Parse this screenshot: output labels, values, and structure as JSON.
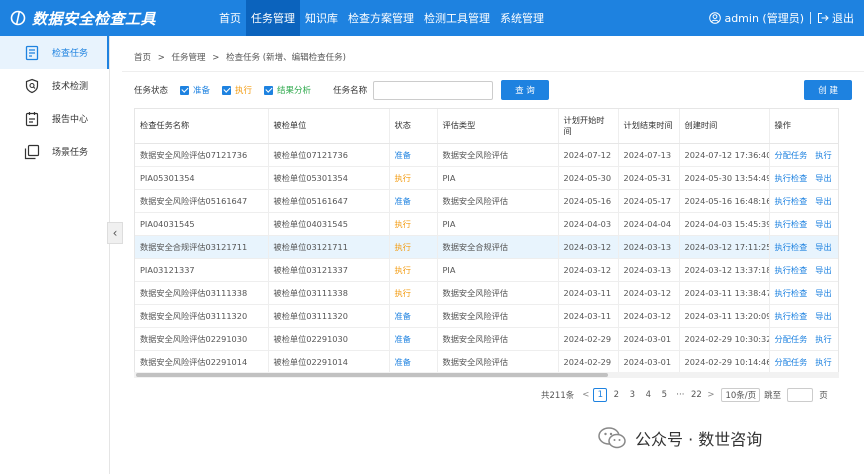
{
  "app": {
    "title": "数据安全检查工具"
  },
  "nav": [
    {
      "label": "首页"
    },
    {
      "label": "任务管理"
    },
    {
      "label": "知识库"
    },
    {
      "label": "检查方案管理"
    },
    {
      "label": "检测工具管理"
    },
    {
      "label": "系统管理"
    }
  ],
  "user": {
    "name": "admin (管理员)",
    "logout": "退出"
  },
  "sidebar": [
    {
      "label": "检查任务"
    },
    {
      "label": "技术检测"
    },
    {
      "label": "报告中心"
    },
    {
      "label": "场景任务"
    }
  ],
  "breadcrumb": [
    "首页",
    ">",
    "任务管理",
    ">",
    "检查任务 (新增、编辑检查任务)"
  ],
  "filter": {
    "status_label": "任务状态",
    "options": [
      "准备",
      "执行",
      "结果分析"
    ],
    "name_label": "任务名称",
    "name_value": "",
    "query": "查 询",
    "create": "创 建"
  },
  "table": {
    "headers": [
      "检查任务名称",
      "被检单位",
      "状态",
      "评估类型",
      "计划开始时间",
      "计划结束时间",
      "创建时间",
      "操作"
    ],
    "rows": [
      {
        "name": "数据安全风险评估07121736",
        "unit": "被检单位07121736",
        "status": "准备",
        "type": "数据安全风险评估",
        "start": "2024-07-12",
        "end": "2024-07-13",
        "created": "2024-07-12 17:36:40",
        "op1": "分配任务",
        "op2": "执行"
      },
      {
        "name": "PIA05301354",
        "unit": "被检单位05301354",
        "status": "执行",
        "type": "PIA",
        "start": "2024-05-30",
        "end": "2024-05-31",
        "created": "2024-05-30 13:54:49",
        "op1": "执行检查",
        "op2": "导出"
      },
      {
        "name": "数据安全风险评估05161647",
        "unit": "被检单位05161647",
        "status": "准备",
        "type": "数据安全风险评估",
        "start": "2024-05-16",
        "end": "2024-05-17",
        "created": "2024-05-16 16:48:16",
        "op1": "执行检查",
        "op2": "导出"
      },
      {
        "name": "PIA04031545",
        "unit": "被检单位04031545",
        "status": "执行",
        "type": "PIA",
        "start": "2024-04-03",
        "end": "2024-04-04",
        "created": "2024-04-03 15:45:39",
        "op1": "执行检查",
        "op2": "导出"
      },
      {
        "name": "数据安全合规评估03121711",
        "unit": "被检单位03121711",
        "status": "执行",
        "type": "数据安全合规评估",
        "start": "2024-03-12",
        "end": "2024-03-13",
        "created": "2024-03-12 17:11:25",
        "op1": "执行检查",
        "op2": "导出"
      },
      {
        "name": "PIA03121337",
        "unit": "被检单位03121337",
        "status": "执行",
        "type": "PIA",
        "start": "2024-03-12",
        "end": "2024-03-13",
        "created": "2024-03-12 13:37:18",
        "op1": "执行检查",
        "op2": "导出"
      },
      {
        "name": "数据安全风险评估03111338",
        "unit": "被检单位03111338",
        "status": "执行",
        "type": "数据安全风险评估",
        "start": "2024-03-11",
        "end": "2024-03-12",
        "created": "2024-03-11 13:38:47",
        "op1": "执行检查",
        "op2": "导出"
      },
      {
        "name": "数据安全风险评估03111320",
        "unit": "被检单位03111320",
        "status": "准备",
        "type": "数据安全风险评估",
        "start": "2024-03-11",
        "end": "2024-03-12",
        "created": "2024-03-11 13:20:09",
        "op1": "执行检查",
        "op2": "导出"
      },
      {
        "name": "数据安全风险评估02291030",
        "unit": "被检单位02291030",
        "status": "准备",
        "type": "数据安全风险评估",
        "start": "2024-02-29",
        "end": "2024-03-01",
        "created": "2024-02-29 10:30:32",
        "op1": "分配任务",
        "op2": "执行"
      },
      {
        "name": "数据安全风险评估02291014",
        "unit": "被检单位02291014",
        "status": "准备",
        "type": "数据安全风险评估",
        "start": "2024-02-29",
        "end": "2024-03-01",
        "created": "2024-02-29 10:14:46",
        "op1": "分配任务",
        "op2": "执行"
      }
    ]
  },
  "pager": {
    "total": "共211条",
    "prev": "<",
    "pages": [
      "1",
      "2",
      "3",
      "4",
      "5",
      "···",
      "22"
    ],
    "next": ">",
    "page_size": "10条/页",
    "jump_label": "跳至",
    "page_suffix": "页"
  },
  "watermark": "公众号 · 数世咨询",
  "colors": {
    "primary": "#1e82e0",
    "ready": "#1e82e0",
    "running": "#f39c12",
    "analysis": "#2ea94c"
  }
}
